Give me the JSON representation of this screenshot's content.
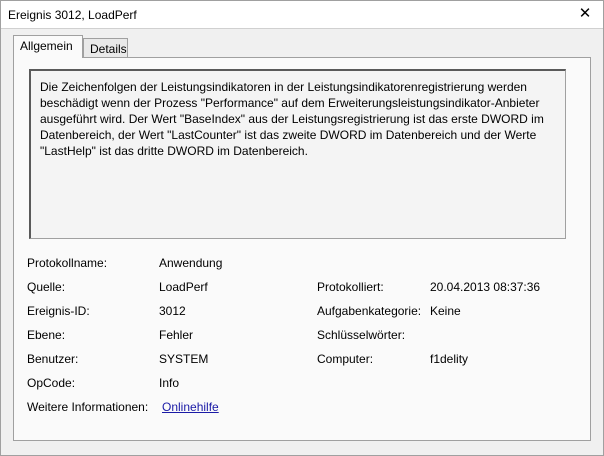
{
  "window": {
    "title": "Ereignis 3012, LoadPerf",
    "close_glyph": "✕"
  },
  "tabs": [
    {
      "label": "Allgemein",
      "active": true
    },
    {
      "label": "Details",
      "active": false
    }
  ],
  "description": "Die Zeichenfolgen der Leistungsindikatoren in der Leistungsindikatorenregistrierung werden\nbeschädigt wenn der Prozess \"Performance\" auf dem Erweiterungsleistungsindikator-Anbieter\nausgeführt wird. Der Wert \"BaseIndex\" aus der Leistungsregistrierung ist das erste DWORD im\nDatenbereich, der Wert \"LastCounter\" ist das zweite DWORD im Datenbereich und der Werte\n\"LastHelp\" ist das dritte DWORD im Datenbereich.",
  "fields": {
    "protokollname_label": "Protokollname:",
    "protokollname_value": "Anwendung",
    "quelle_label": "Quelle:",
    "quelle_value": "LoadPerf",
    "protokolliert_label": "Protokolliert:",
    "protokolliert_value": "20.04.2013 08:37:36",
    "ereignis_id_label": "Ereignis-ID:",
    "ereignis_id_value": "3012",
    "aufgabenkategorie_label": "Aufgabenkategorie:",
    "aufgabenkategorie_value": "Keine",
    "ebene_label": "Ebene:",
    "ebene_value": "Fehler",
    "schluesselwoerter_label": "Schlüsselwörter:",
    "schluesselwoerter_value": "",
    "benutzer_label": "Benutzer:",
    "benutzer_value": "SYSTEM",
    "computer_label": "Computer:",
    "computer_value": "f1delity",
    "opcode_label": "OpCode:",
    "opcode_value": "Info",
    "weitere_label": "Weitere Informationen:",
    "weitere_link": "Onlinehilfe"
  },
  "colors": {
    "link": "#1a1aa6",
    "window_bg": "#f0f0f0",
    "panel_bg": "#fafafa"
  }
}
